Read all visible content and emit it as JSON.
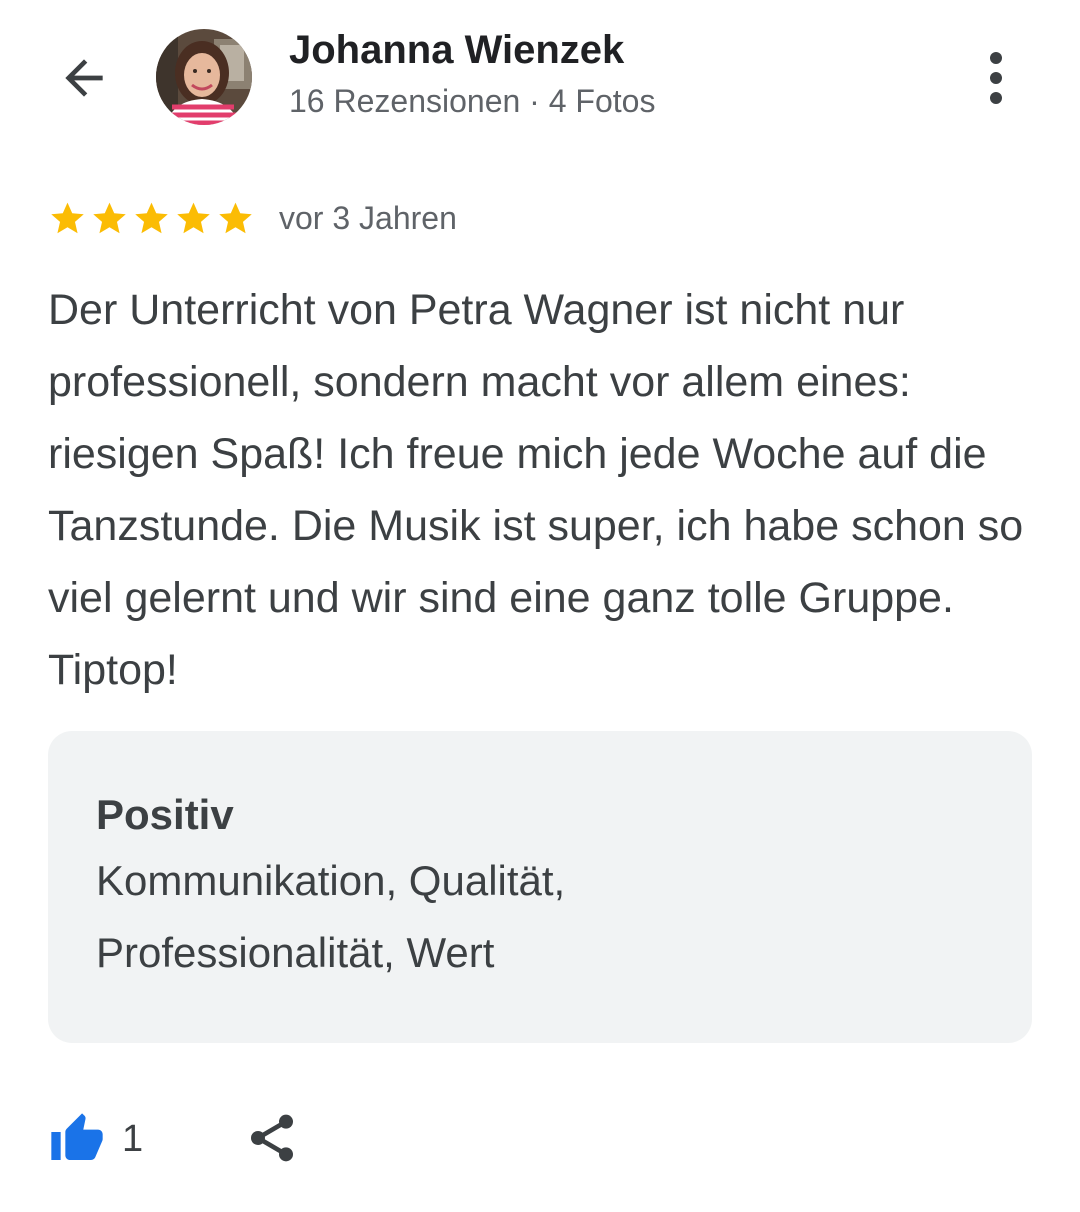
{
  "header": {
    "reviewer_name": "Johanna Wienzek",
    "reviewer_stats": "16 Rezensionen · 4 Fotos",
    "icons": {
      "back": "arrow-back-icon",
      "more": "more-vert-icon"
    }
  },
  "review": {
    "rating": 5,
    "rating_max": 5,
    "star_color": "#fbbc04",
    "date": "vor 3 Jahren",
    "text": "Der Unterricht von Petra Wagner ist nicht nur professionell, sondern macht vor allem eines: riesigen Spaß! Ich freue mich jede Woche auf die Tanzstunde. Die Musik ist super, ich habe schon so viel gelernt und wir sind eine ganz tolle Gruppe. Tiptop!"
  },
  "attributes": {
    "heading": "Positiv",
    "values": "Kommunikation, Qualität, Professionalität, Wert"
  },
  "actions": {
    "like_count": "1",
    "like_color": "#1a73e8",
    "icons": {
      "like": "thumb-up-icon",
      "share": "share-icon"
    }
  }
}
